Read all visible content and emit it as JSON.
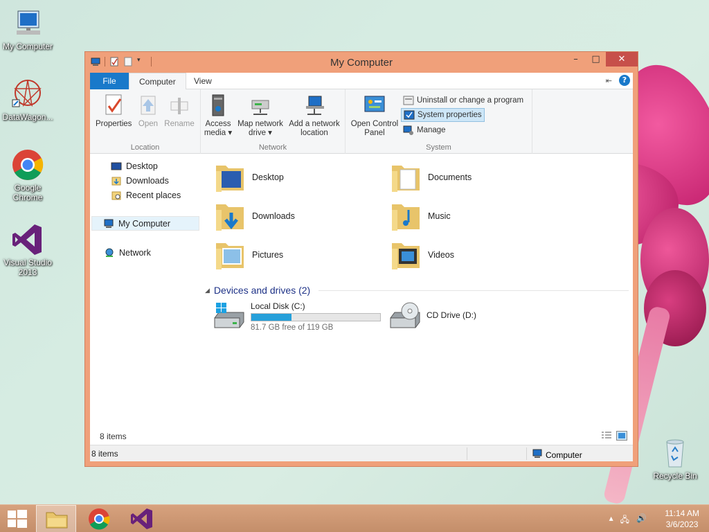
{
  "desktop": {
    "icons": [
      {
        "label": "My Computer"
      },
      {
        "label": "DataWagon..."
      },
      {
        "label": "Google Chrome"
      },
      {
        "label": "Visual Studio 2013"
      },
      {
        "label": "Recycle Bin"
      }
    ]
  },
  "window": {
    "title": "My Computer",
    "controls": {
      "minimize": "–",
      "maximize": "□",
      "close": "✕"
    },
    "tabs": {
      "file": "File",
      "computer": "Computer",
      "view": "View"
    },
    "help": "?",
    "ribbon": {
      "location": {
        "label": "Location",
        "buttons": [
          "Properties",
          "Open",
          "Rename"
        ]
      },
      "network": {
        "label": "Network",
        "access_media_1": "Access",
        "access_media_2": "media ▾",
        "map_drive_1": "Map network",
        "map_drive_2": "drive ▾",
        "add_location_1": "Add a network",
        "add_location_2": "location"
      },
      "system": {
        "label": "System",
        "control_panel_1": "Open Control",
        "control_panel_2": "Panel",
        "uninstall": "Uninstall or change a program",
        "system_properties": "System properties",
        "manage": "Manage"
      }
    },
    "nav": {
      "desktop": "Desktop",
      "downloads": "Downloads",
      "recent": "Recent places",
      "my_computer": "My Computer",
      "network": "Network"
    },
    "folders": {
      "desktop": "Desktop",
      "documents": "Documents",
      "downloads": "Downloads",
      "music": "Music",
      "pictures": "Pictures",
      "videos": "Videos"
    },
    "devices_header": "Devices and drives (2)",
    "drives": {
      "c_name": "Local Disk (C:)",
      "c_free": "81.7 GB free of 119 GB",
      "c_used_fraction": 0.313,
      "d_name": "CD Drive (D:)"
    },
    "inner_count": "8 items",
    "status": {
      "count": "8 items",
      "location": "Computer"
    }
  },
  "taskbar": {
    "time": "11:14 AM",
    "date": "3/6/2023"
  },
  "colors": {
    "accent": "#1979ca",
    "titlebar": "#f0a07a",
    "close": "#c7504a"
  }
}
